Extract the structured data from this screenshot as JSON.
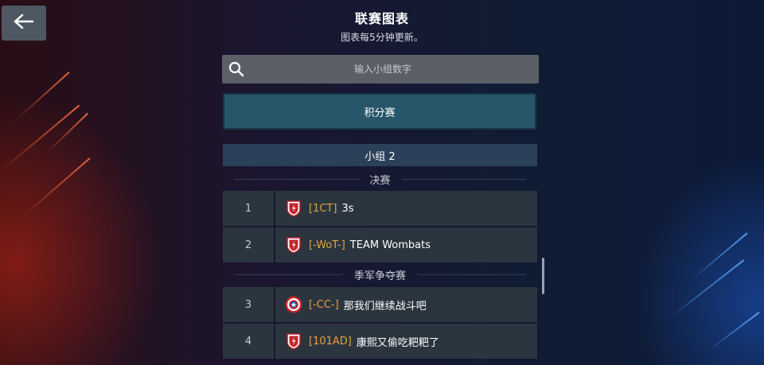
{
  "header": {
    "back_icon": "arrow-left-icon",
    "title": "联赛图表",
    "subtitle": "图表每5分钟更新。"
  },
  "search": {
    "icon": "search-icon",
    "placeholder": "输入小组数字",
    "value": ""
  },
  "mode_button": {
    "label": "积分赛"
  },
  "group": {
    "label": "小组 2"
  },
  "sections": [
    {
      "label": "决赛"
    },
    {
      "label": "季军争夺赛"
    }
  ],
  "rows": [
    {
      "rank": "1",
      "tag": "[1CT]",
      "name": "3s",
      "emblem": "shield-emblem-icon"
    },
    {
      "rank": "2",
      "tag": "[-WoT-]",
      "name": "TEAM Wombats",
      "emblem": "shield-emblem-icon"
    },
    {
      "rank": "3",
      "tag": "[-CC-]",
      "name": "那我们继续战斗吧",
      "emblem": "captain-shield-icon"
    },
    {
      "rank": "4",
      "tag": "[101AD]",
      "name": "康熙又偷吃粑粑了",
      "emblem": "shield-emblem-icon"
    }
  ],
  "colors": {
    "tag": "#e4a244",
    "mode_button_bg": "#275569",
    "group_header_bg": "#2a4159",
    "row_bg": "#2b353f"
  }
}
